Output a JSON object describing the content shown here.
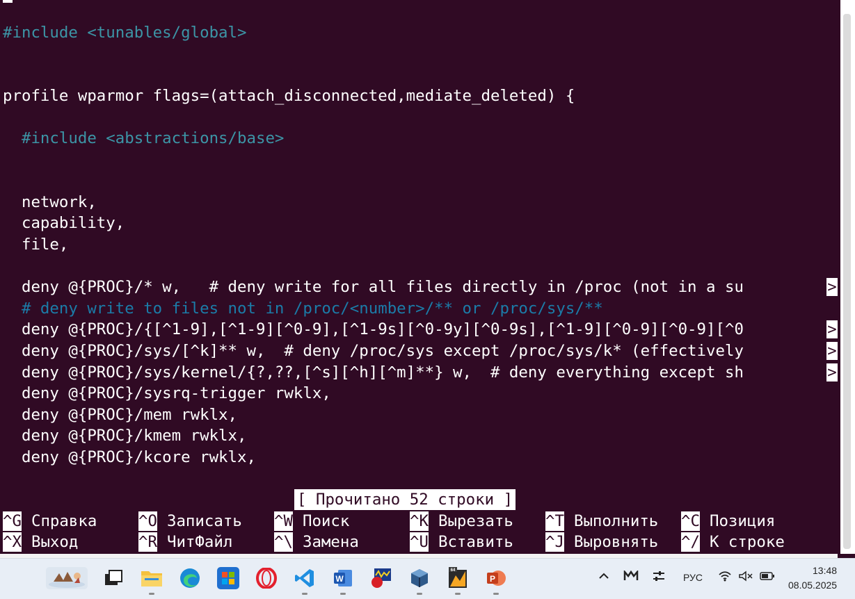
{
  "editor": {
    "lines": {
      "l1": "#include <tunables/global>",
      "l2": "profile wparmor flags=(attach_disconnected,mediate_deleted) {",
      "l3": "  #include <abstractions/base>",
      "l4": "  network,",
      "l5": "  capability,",
      "l6": "  file,",
      "l7": "  deny @{PROC}/* w,   # deny write for all files directly in /proc (not in a su",
      "l8": "  # deny write to files not in /proc/<number>/** or /proc/sys/**",
      "l9": "  deny @{PROC}/{[^1-9],[^1-9][^0-9],[^1-9s][^0-9y][^0-9s],[^1-9][^0-9][^0-9][^0",
      "l10": "  deny @{PROC}/sys/[^k]** w,  # deny /proc/sys except /proc/sys/k* (effectively",
      "l11": "  deny @{PROC}/sys/kernel/{?,??,[^s][^h][^m]**} w,  # deny everything except sh",
      "l12": "  deny @{PROC}/sysrq-trigger rwklx,",
      "l13": "  deny @{PROC}/mem rwklx,",
      "l14": "  deny @{PROC}/kmem rwklx,",
      "l15": "  deny @{PROC}/kcore rwklx,"
    },
    "overflow_marker": ">",
    "status": "[ Прочитано 52 строки ]"
  },
  "shortcuts": {
    "s1": {
      "key": "^G",
      "label": "Справка"
    },
    "s2": {
      "key": "^O",
      "label": "Записать"
    },
    "s3": {
      "key": "^W",
      "label": "Поиск"
    },
    "s4": {
      "key": "^K",
      "label": "Вырезать"
    },
    "s5": {
      "key": "^T",
      "label": "Выполнить"
    },
    "s6": {
      "key": "^C",
      "label": "Позиция"
    },
    "s7": {
      "key": "^X",
      "label": "Выход"
    },
    "s8": {
      "key": "^R",
      "label": "ЧитФайл"
    },
    "s9": {
      "key": "^\\",
      "label": "Замена"
    },
    "s10": {
      "key": "^U",
      "label": "Вставить"
    },
    "s11": {
      "key": "^J",
      "label": "Выровнять"
    },
    "s12": {
      "key": "^/",
      "label": "К строке"
    }
  },
  "taskbar": {
    "apps": [
      "weather-widget-icon",
      "task-view-icon",
      "file-explorer-icon",
      "edge-icon",
      "store-icon",
      "opera-icon",
      "vscode-icon",
      "word-icon",
      "app-icon",
      "virtualbox-icon",
      "app64-icon",
      "powerpoint-icon"
    ],
    "language": "РУС",
    "time": "13:48",
    "date": "08.05.2025"
  },
  "colors": {
    "background": "#300a24",
    "text": "#ffffff",
    "preprocessor": "#3c95a6",
    "comment": "#1b7ca8"
  }
}
